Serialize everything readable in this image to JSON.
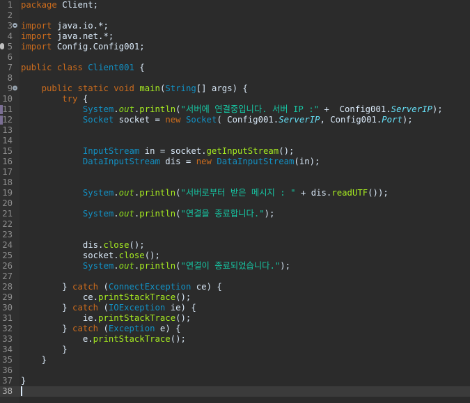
{
  "editor": {
    "lines": [
      {
        "num": "1",
        "tokens": [
          {
            "t": "package",
            "c": "kw"
          },
          {
            "t": " Client;",
            "c": "pl"
          }
        ]
      },
      {
        "num": "2",
        "tokens": []
      },
      {
        "num": "3",
        "fold": true,
        "tokens": [
          {
            "t": "import",
            "c": "kw"
          },
          {
            "t": " java.io.*;",
            "c": "pl"
          }
        ]
      },
      {
        "num": "4",
        "tokens": [
          {
            "t": "import",
            "c": "kw"
          },
          {
            "t": " java.net.*;",
            "c": "pl"
          }
        ]
      },
      {
        "num": "5",
        "tokens": [
          {
            "t": "import",
            "c": "kw"
          },
          {
            "t": " Config.Config001;",
            "c": "pl"
          }
        ]
      },
      {
        "num": "6",
        "tokens": []
      },
      {
        "num": "7",
        "tokens": [
          {
            "t": "public",
            "c": "kw"
          },
          {
            "t": " ",
            "c": "pl"
          },
          {
            "t": "class",
            "c": "kw"
          },
          {
            "t": " ",
            "c": "pl"
          },
          {
            "t": "Client001",
            "c": "ty"
          },
          {
            "t": " {",
            "c": "pl"
          }
        ]
      },
      {
        "num": "8",
        "tokens": []
      },
      {
        "num": "9",
        "fold": true,
        "tokens": [
          {
            "t": "    ",
            "c": "pl"
          },
          {
            "t": "public",
            "c": "kw"
          },
          {
            "t": " ",
            "c": "pl"
          },
          {
            "t": "static",
            "c": "kw"
          },
          {
            "t": " ",
            "c": "pl"
          },
          {
            "t": "void",
            "c": "kw"
          },
          {
            "t": " ",
            "c": "pl"
          },
          {
            "t": "main",
            "c": "fn"
          },
          {
            "t": "(",
            "c": "pl"
          },
          {
            "t": "String",
            "c": "ty"
          },
          {
            "t": "[] ",
            "c": "pl"
          },
          {
            "t": "args",
            "c": "pl"
          },
          {
            "t": ") {",
            "c": "pl"
          }
        ]
      },
      {
        "num": "10",
        "tokens": [
          {
            "t": "        ",
            "c": "pl"
          },
          {
            "t": "try",
            "c": "kw"
          },
          {
            "t": " {",
            "c": "pl"
          }
        ]
      },
      {
        "num": "11",
        "marker": true,
        "tokens": [
          {
            "t": "            ",
            "c": "pl"
          },
          {
            "t": "System",
            "c": "ty"
          },
          {
            "t": ".",
            "c": "pl"
          },
          {
            "t": "out",
            "c": "st"
          },
          {
            "t": ".",
            "c": "pl"
          },
          {
            "t": "println",
            "c": "fn"
          },
          {
            "t": "(",
            "c": "pl"
          },
          {
            "t": "\"서버에 연결중입니다. 서버 IP :\"",
            "c": "str"
          },
          {
            "t": " +  Config001.",
            "c": "pl"
          },
          {
            "t": "ServerIP",
            "c": "fi"
          },
          {
            "t": ");",
            "c": "pl"
          }
        ]
      },
      {
        "num": "12",
        "marker": true,
        "tokens": [
          {
            "t": "            ",
            "c": "pl"
          },
          {
            "t": "Socket",
            "c": "ty"
          },
          {
            "t": " ",
            "c": "pl"
          },
          {
            "t": "socket",
            "c": "pl"
          },
          {
            "t": " = ",
            "c": "pl"
          },
          {
            "t": "new",
            "c": "kw"
          },
          {
            "t": " ",
            "c": "pl"
          },
          {
            "t": "Socket",
            "c": "ty"
          },
          {
            "t": "( Config001.",
            "c": "pl"
          },
          {
            "t": "ServerIP",
            "c": "fi"
          },
          {
            "t": ", Config001.",
            "c": "pl"
          },
          {
            "t": "Port",
            "c": "fi"
          },
          {
            "t": ");",
            "c": "pl"
          }
        ]
      },
      {
        "num": "13",
        "tokens": []
      },
      {
        "num": "14",
        "tokens": []
      },
      {
        "num": "15",
        "tokens": [
          {
            "t": "            ",
            "c": "pl"
          },
          {
            "t": "InputStream",
            "c": "ty"
          },
          {
            "t": " in = socket.",
            "c": "pl"
          },
          {
            "t": "getInputStream",
            "c": "fn"
          },
          {
            "t": "();",
            "c": "pl"
          }
        ]
      },
      {
        "num": "16",
        "tokens": [
          {
            "t": "            ",
            "c": "pl"
          },
          {
            "t": "DataInputStream",
            "c": "ty"
          },
          {
            "t": " dis = ",
            "c": "pl"
          },
          {
            "t": "new",
            "c": "kw"
          },
          {
            "t": " ",
            "c": "pl"
          },
          {
            "t": "DataInputStream",
            "c": "ty"
          },
          {
            "t": "(in);",
            "c": "pl"
          }
        ]
      },
      {
        "num": "17",
        "tokens": []
      },
      {
        "num": "18",
        "tokens": []
      },
      {
        "num": "19",
        "tokens": [
          {
            "t": "            ",
            "c": "pl"
          },
          {
            "t": "System",
            "c": "ty"
          },
          {
            "t": ".",
            "c": "pl"
          },
          {
            "t": "out",
            "c": "st"
          },
          {
            "t": ".",
            "c": "pl"
          },
          {
            "t": "println",
            "c": "fn"
          },
          {
            "t": "(",
            "c": "pl"
          },
          {
            "t": "\"서버로부터 받은 메시지 : \"",
            "c": "str"
          },
          {
            "t": " + dis.",
            "c": "pl"
          },
          {
            "t": "readUTF",
            "c": "fn"
          },
          {
            "t": "());",
            "c": "pl"
          }
        ]
      },
      {
        "num": "20",
        "tokens": []
      },
      {
        "num": "21",
        "tokens": [
          {
            "t": "            ",
            "c": "pl"
          },
          {
            "t": "System",
            "c": "ty"
          },
          {
            "t": ".",
            "c": "pl"
          },
          {
            "t": "out",
            "c": "st"
          },
          {
            "t": ".",
            "c": "pl"
          },
          {
            "t": "println",
            "c": "fn"
          },
          {
            "t": "(",
            "c": "pl"
          },
          {
            "t": "\"연결을 종료합니다.\"",
            "c": "str"
          },
          {
            "t": ");",
            "c": "pl"
          }
        ]
      },
      {
        "num": "22",
        "tokens": []
      },
      {
        "num": "23",
        "tokens": []
      },
      {
        "num": "24",
        "tokens": [
          {
            "t": "            dis.",
            "c": "pl"
          },
          {
            "t": "close",
            "c": "fn"
          },
          {
            "t": "();",
            "c": "pl"
          }
        ]
      },
      {
        "num": "25",
        "tokens": [
          {
            "t": "            socket.",
            "c": "pl"
          },
          {
            "t": "close",
            "c": "fn"
          },
          {
            "t": "();",
            "c": "pl"
          }
        ]
      },
      {
        "num": "26",
        "tokens": [
          {
            "t": "            ",
            "c": "pl"
          },
          {
            "t": "System",
            "c": "ty"
          },
          {
            "t": ".",
            "c": "pl"
          },
          {
            "t": "out",
            "c": "st"
          },
          {
            "t": ".",
            "c": "pl"
          },
          {
            "t": "println",
            "c": "fn"
          },
          {
            "t": "(",
            "c": "pl"
          },
          {
            "t": "\"연결이 종료되었습니다.\"",
            "c": "str"
          },
          {
            "t": ");",
            "c": "pl"
          }
        ]
      },
      {
        "num": "27",
        "tokens": []
      },
      {
        "num": "28",
        "tokens": [
          {
            "t": "        } ",
            "c": "pl"
          },
          {
            "t": "catch",
            "c": "kw"
          },
          {
            "t": " (",
            "c": "pl"
          },
          {
            "t": "ConnectException",
            "c": "ty"
          },
          {
            "t": " ce) {",
            "c": "pl"
          }
        ]
      },
      {
        "num": "29",
        "tokens": [
          {
            "t": "            ce.",
            "c": "pl"
          },
          {
            "t": "printStackTrace",
            "c": "fn"
          },
          {
            "t": "();",
            "c": "pl"
          }
        ]
      },
      {
        "num": "30",
        "tokens": [
          {
            "t": "        } ",
            "c": "pl"
          },
          {
            "t": "catch",
            "c": "kw"
          },
          {
            "t": " (",
            "c": "pl"
          },
          {
            "t": "IOException",
            "c": "ty"
          },
          {
            "t": " ie) {",
            "c": "pl"
          }
        ]
      },
      {
        "num": "31",
        "tokens": [
          {
            "t": "            ie.",
            "c": "pl"
          },
          {
            "t": "printStackTrace",
            "c": "fn"
          },
          {
            "t": "();",
            "c": "pl"
          }
        ]
      },
      {
        "num": "32",
        "tokens": [
          {
            "t": "        } ",
            "c": "pl"
          },
          {
            "t": "catch",
            "c": "kw"
          },
          {
            "t": " (",
            "c": "pl"
          },
          {
            "t": "Exception",
            "c": "ty"
          },
          {
            "t": " e) {",
            "c": "pl"
          }
        ]
      },
      {
        "num": "33",
        "tokens": [
          {
            "t": "            e.",
            "c": "pl"
          },
          {
            "t": "printStackTrace",
            "c": "fn"
          },
          {
            "t": "();",
            "c": "pl"
          }
        ]
      },
      {
        "num": "34",
        "tokens": [
          {
            "t": "        }",
            "c": "pl"
          }
        ]
      },
      {
        "num": "35",
        "tokens": [
          {
            "t": "    }",
            "c": "pl"
          }
        ]
      },
      {
        "num": "36",
        "tokens": []
      },
      {
        "num": "37",
        "tokens": [
          {
            "t": "}",
            "c": "pl"
          }
        ]
      },
      {
        "num": "38",
        "current": true,
        "tokens": []
      }
    ]
  }
}
